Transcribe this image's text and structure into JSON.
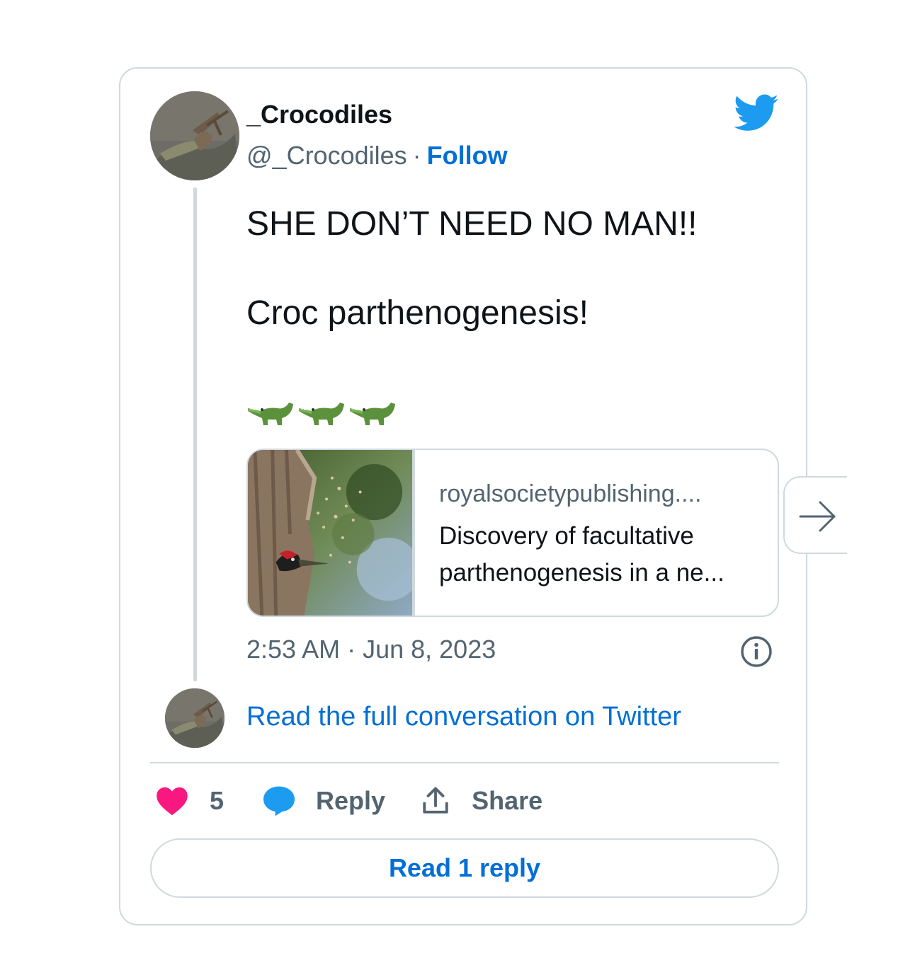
{
  "user": {
    "display_name": "_Crocodiles",
    "handle": "@_Crocodiles",
    "separator": "·",
    "follow_label": "Follow"
  },
  "tweet": {
    "line1": "SHE DON’T NEED NO MAN!!",
    "line2": "Croc parthenogenesis!",
    "emoji": [
      "crocodile-emoji",
      "crocodile-emoji",
      "crocodile-emoji"
    ]
  },
  "link_card": {
    "domain": "royalsocietypublishing....",
    "title_line1": "Discovery of facultative",
    "title_line2": "parthenogenesis in a ne..."
  },
  "meta": {
    "time": "2:53 AM",
    "separator": "·",
    "date": "Jun 8, 2023"
  },
  "conversation_link": "Read the full conversation on Twitter",
  "actions": {
    "like_count": "5",
    "reply_label": "Reply",
    "share_label": "Share"
  },
  "read_reply_label": "Read 1 reply",
  "icons": {
    "brand": "twitter-bird-icon",
    "like": "heart-icon",
    "reply": "speech-bubble-icon",
    "share": "share-upload-icon",
    "info": "info-icon",
    "next": "arrow-right-icon"
  },
  "colors": {
    "twitter_blue": "#1d9bf0",
    "link_blue": "#006fd6",
    "heart_pink": "#f91880",
    "secondary_text": "#536471",
    "border": "#cfd9de"
  }
}
